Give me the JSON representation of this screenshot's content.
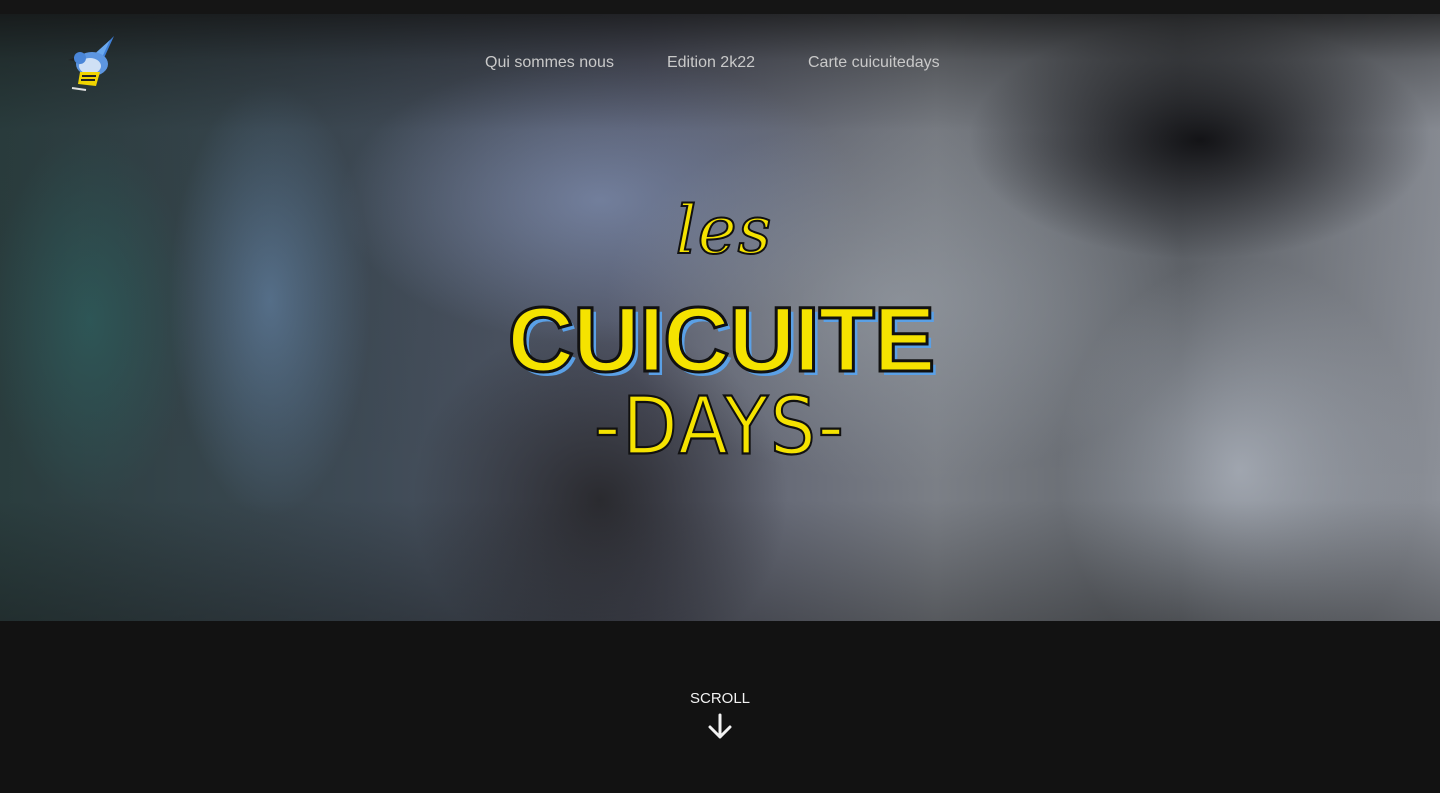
{
  "nav": {
    "items": [
      {
        "label": "Qui sommes nous"
      },
      {
        "label": "Edition 2k22"
      },
      {
        "label": "Carte cuicuitedays"
      }
    ]
  },
  "hero": {
    "title_prefix": "les",
    "title_main": "CUICUITE",
    "title_suffix": "-DAYS-"
  },
  "scroll": {
    "label": "SCROLL",
    "icon": "arrow-down-icon"
  },
  "colors": {
    "background": "#121212",
    "title_yellow": "#f5e300",
    "title_shadow": "#5aa0e6",
    "nav_text": "#c9c9c9"
  }
}
